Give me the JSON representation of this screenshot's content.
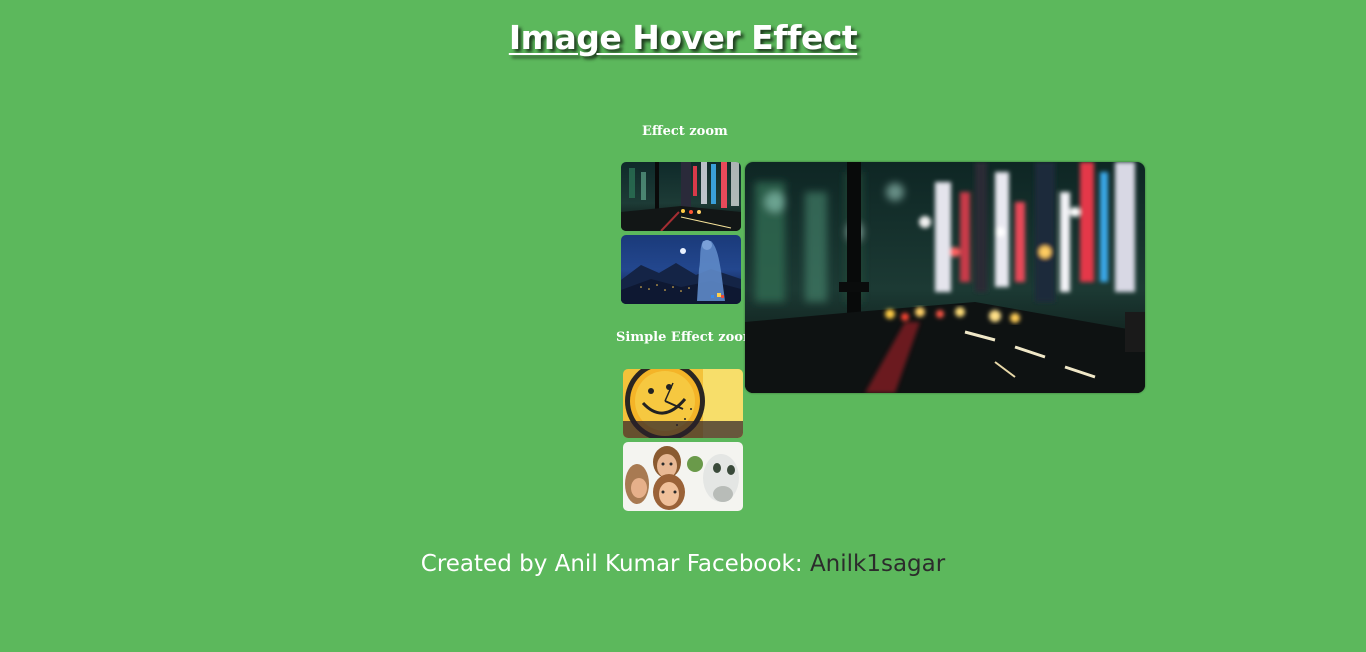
{
  "header": {
    "title": "Image Hover Effect"
  },
  "sections": [
    {
      "heading": "Effect zoom",
      "images": [
        {
          "icon": "city-night-street-image"
        },
        {
          "icon": "night-mountain-landscape-image"
        }
      ]
    },
    {
      "heading": "Simple Effect zoom",
      "images": [
        {
          "icon": "smiley-clock-image"
        },
        {
          "icon": "animated-characters-image"
        }
      ]
    }
  ],
  "preview": {
    "icon": "city-night-street-zoomed-image"
  },
  "footer": {
    "credit_text": "Created by Anil Kumar Facebook:",
    "facebook_link": "Anilk1sagar"
  },
  "colors": {
    "background": "#5cb85c",
    "text": "#ffffff",
    "link": "#2c2c2c"
  }
}
